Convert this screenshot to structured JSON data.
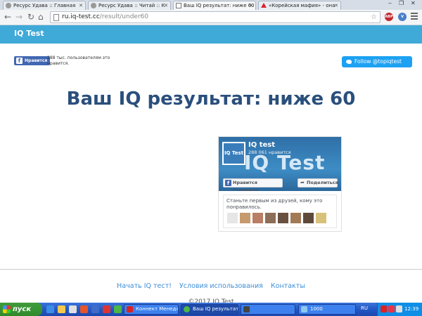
{
  "browser": {
    "tabs": [
      {
        "label": "Ресурс Удава :: Главная",
        "active": false
      },
      {
        "label": "Ресурс Удава :: Читай :: К",
        "active": false
      },
      {
        "label": "Ваш IQ результат: ниже 60",
        "active": true
      },
      {
        "label": "«Корейская мафия» - она",
        "active": false
      }
    ],
    "url_host": "ru.iq-test.cc",
    "url_path": "/result/under60",
    "extensions": [
      {
        "label": "ABP",
        "badge": "2",
        "color": "#c0262d"
      },
      {
        "label": "V",
        "badge": "2",
        "color": "#4a7fc9"
      }
    ]
  },
  "site": {
    "brand": "IQ Test",
    "fb_like_label": "Нравится",
    "fb_like_count": "288 тыс. пользователям это нравится.",
    "twitter_label": "Follow @topiqtest",
    "result_title": "Ваш IQ результат: ниже 60"
  },
  "fb_page": {
    "name": "IQ test",
    "likes": "288 061 нравится",
    "cover_text": "IQ Test",
    "avatar_text": "IQ Test",
    "like_page_label": "Нравится Страница",
    "share_label": "Поделиться",
    "friends_text": "Станьте первым из друзей, кому это понравилось."
  },
  "footer": {
    "links": [
      "Начать IQ тест!",
      "Условия использования",
      "Контакты"
    ],
    "copyright": "©2017 IQ Test"
  },
  "taskbar": {
    "start_label": "пуск",
    "tasks": [
      "Коннект Менеджер",
      "Ваш IQ результат...",
      "",
      "1000"
    ],
    "language": "RU",
    "clock": "12:39"
  },
  "colors": {
    "header": "#3fa9d8",
    "title": "#2a4f7c",
    "facebook": "#4267b2",
    "twitter": "#1da1f2",
    "link": "#3f8ed6"
  }
}
